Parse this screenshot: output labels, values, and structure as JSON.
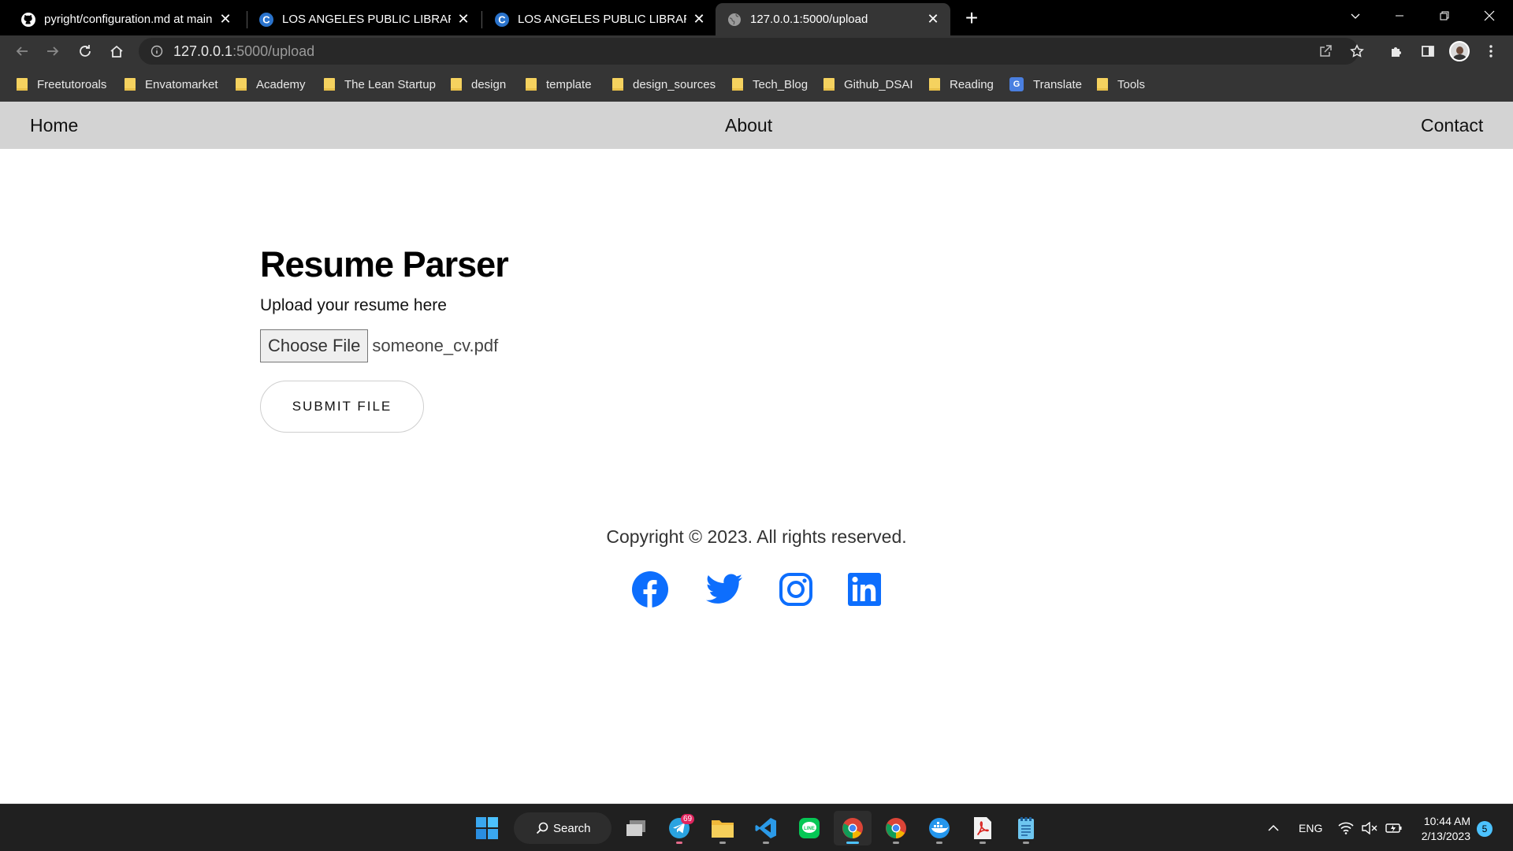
{
  "browser": {
    "tabs": [
      {
        "title": "pyright/configuration.md at main · microsoft/pyright",
        "icon": "github-icon",
        "active": false
      },
      {
        "title": "LOS ANGELES PUBLIC LIBRARY | Coursera",
        "icon": "coursera-icon",
        "active": false
      },
      {
        "title": "LOS ANGELES PUBLIC LIBRARY | Coursera",
        "icon": "coursera-icon",
        "active": false
      },
      {
        "title": "127.0.0.1:5000/upload",
        "icon": "globe-icon",
        "active": true
      }
    ],
    "url_host": "127.0.0.1",
    "url_path": ":5000/upload",
    "bookmarks": [
      {
        "label": "Freetutoroals",
        "icon": "folder-icon"
      },
      {
        "label": "Envatomarket",
        "icon": "folder-icon"
      },
      {
        "label": "Academy",
        "icon": "folder-icon"
      },
      {
        "label": "The Lean Startup",
        "icon": "folder-icon"
      },
      {
        "label": "design",
        "icon": "folder-icon"
      },
      {
        "label": "template",
        "icon": "folder-icon"
      },
      {
        "label": "design_sources",
        "icon": "folder-icon"
      },
      {
        "label": "Tech_Blog",
        "icon": "folder-icon"
      },
      {
        "label": "Github_DSAI",
        "icon": "folder-icon"
      },
      {
        "label": "Reading",
        "icon": "folder-icon"
      },
      {
        "label": "Translate",
        "icon": "google-translate-icon"
      },
      {
        "label": "Tools",
        "icon": "folder-icon"
      }
    ]
  },
  "site": {
    "nav": {
      "home": "Home",
      "about": "About",
      "contact": "Contact"
    },
    "title": "Resume Parser",
    "upload_label": "Upload your resume here",
    "choose_file_label": "Choose File",
    "file_name": "someone_cv.pdf",
    "submit_label": "SUBMIT FILE",
    "copyright": "Copyright © 2023. All rights reserved.",
    "socials": [
      "facebook-icon",
      "twitter-icon",
      "instagram-icon",
      "linkedin-icon"
    ],
    "social_color": "#0d6efd"
  },
  "taskbar": {
    "search_label": "Search",
    "telegram_badge": "69",
    "language": "ENG",
    "time": "10:44 AM",
    "date": "2/13/2023",
    "notification_count": "5"
  },
  "colors": {
    "navbar_bg": "#d3d3d3",
    "chrome_toolbar": "#353535",
    "taskbar_bg": "#202020",
    "accent": "#4cc2ff"
  }
}
